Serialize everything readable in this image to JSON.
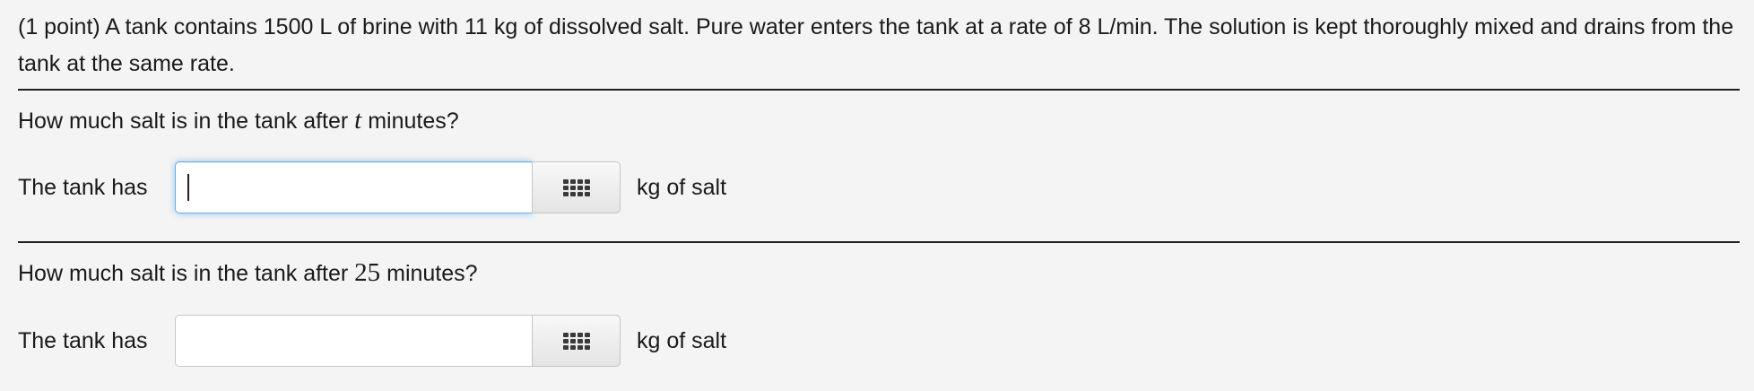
{
  "problem": {
    "intro": "(1 point) A tank contains 1500 L of brine with 11 kg of dissolved salt. Pure water enters the tank at a rate of 8 L/min. The solution is kept thoroughly mixed and drains from the tank at the same rate."
  },
  "parts": [
    {
      "question_before": "How much salt is in the tank after",
      "question_math": "t",
      "question_after": "minutes?",
      "prefix": "The tank has",
      "value": "",
      "suffix": "kg of salt",
      "palette_icon": "grid-icon",
      "focused": true
    },
    {
      "question_before": "How much salt is in the tank after",
      "question_math": "25",
      "question_after": "minutes?",
      "prefix": "The tank has",
      "value": "",
      "suffix": "kg of salt",
      "palette_icon": "grid-icon",
      "focused": false
    }
  ],
  "colors": {
    "background": "#f4f4f4",
    "focus_border": "#66afe9",
    "rule": "#1f1f1f"
  }
}
